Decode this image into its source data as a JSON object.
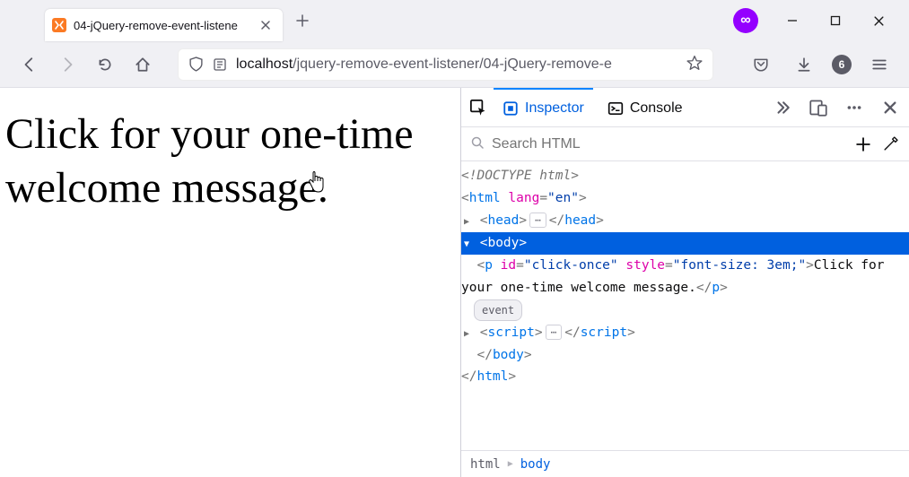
{
  "tab": {
    "title": "04-jQuery-remove-event-listene"
  },
  "url": {
    "host": "localhost",
    "path": "/jquery-remove-event-listener/04-jQuery-remove-e"
  },
  "toolbar_badge": {
    "count": "6"
  },
  "ext": {
    "glyph": "∞"
  },
  "page": {
    "text": "Click for your one-time welcome message."
  },
  "devtools": {
    "tabs": {
      "inspector": "Inspector",
      "console": "Console"
    },
    "search_placeholder": "Search HTML",
    "markup": {
      "doctype": "<!DOCTYPE html>",
      "html_open_1": "html",
      "html_lang_attr": "lang",
      "html_lang_val": "\"en\"",
      "head": "head",
      "body": "body",
      "p_tag": "p",
      "p_id_attr": "id",
      "p_id_val": "\"click-once\"",
      "p_style_attr": "style",
      "p_style_val": "\"font-size: 3em;\"",
      "p_text": "Click for your one-time welcome message.",
      "event_badge": "event",
      "script": "script"
    },
    "breadcrumbs": {
      "html": "html",
      "body": "body"
    }
  }
}
